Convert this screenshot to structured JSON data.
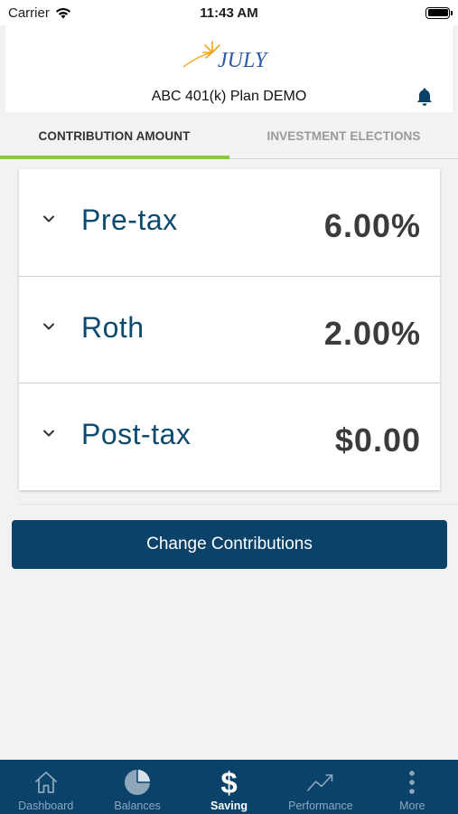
{
  "status_bar": {
    "carrier": "Carrier",
    "time": "11:43 AM"
  },
  "header": {
    "logo_text": "JULY",
    "plan_title": "ABC 401(k) Plan DEMO",
    "notification_icon": "bell-icon"
  },
  "tabs": [
    {
      "label": "CONTRIBUTION AMOUNT",
      "active": true
    },
    {
      "label": "INVESTMENT ELECTIONS",
      "active": false
    }
  ],
  "contributions": [
    {
      "label": "Pre-tax",
      "value": "6.00%"
    },
    {
      "label": "Roth",
      "value": "2.00%"
    },
    {
      "label": "Post-tax",
      "value": "$0.00"
    }
  ],
  "actions": {
    "change_label": "Change Contributions"
  },
  "bottom_nav": [
    {
      "label": "Dashboard",
      "icon": "home-icon",
      "active": false
    },
    {
      "label": "Balances",
      "icon": "pie-chart-icon",
      "active": false
    },
    {
      "label": "Saving",
      "icon": "dollar-icon",
      "active": true
    },
    {
      "label": "Performance",
      "icon": "trend-icon",
      "active": false
    },
    {
      "label": "More",
      "icon": "more-vertical-icon",
      "active": false
    }
  ],
  "colors": {
    "brand_navy": "#0a426a",
    "accent_green": "#8cc63f",
    "label_blue": "#0d4a6e",
    "logo_orange": "#f3a31b",
    "logo_blue": "#2b5aa8"
  }
}
